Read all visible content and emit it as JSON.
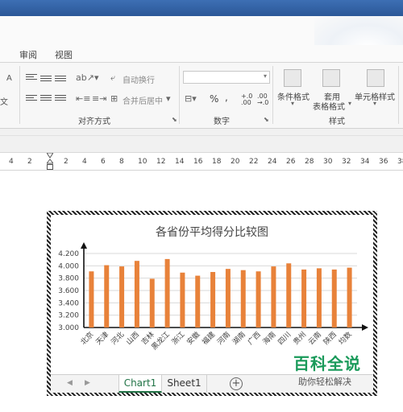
{
  "ribbon": {
    "tabs": [
      "审阅",
      "视图"
    ],
    "wrap_text": "自动换行",
    "merge_center": "合并后居中",
    "alignment_group": "对齐方式",
    "number_group": "数字",
    "percent": "%",
    "comma": ",",
    "inc_decimal": "+.0 .00",
    "dec_decimal": ".00 →.0",
    "cond_format": "条件格式",
    "table_format_1": "套用",
    "table_format_2": "表格格式",
    "cell_style": "单元格样式",
    "styles_group": "样式",
    "left_partial_1": "A",
    "left_partial_2": "文"
  },
  "ruler": {
    "labels": [
      "4",
      "2",
      "2",
      "4",
      "6",
      "8",
      "10",
      "12",
      "14",
      "16",
      "18",
      "20",
      "22",
      "24",
      "26",
      "28",
      "30",
      "32",
      "34",
      "36",
      "38"
    ]
  },
  "chart_data": {
    "type": "bar",
    "title": "各省份平均得分比较图",
    "categories": [
      "北京",
      "天津",
      "河北",
      "山西",
      "吉林",
      "黑龙江",
      "浙江",
      "安徽",
      "福建",
      "河南",
      "湖南",
      "广西",
      "海南",
      "四川",
      "贵州",
      "云南",
      "陕西",
      "均数"
    ],
    "values": [
      3.91,
      4.01,
      3.99,
      4.08,
      3.79,
      4.11,
      3.89,
      3.84,
      3.9,
      3.95,
      3.93,
      3.91,
      3.99,
      4.04,
      3.94,
      3.96,
      3.94,
      3.97
    ],
    "ylim": [
      3.0,
      4.2
    ],
    "yticks": [
      "4.200",
      "4.000",
      "3.800",
      "3.600",
      "3.400",
      "3.200",
      "3.000"
    ],
    "bar_color": "#e8823a",
    "grid": true
  },
  "sheets": {
    "tabs": [
      "Chart1",
      "Sheet1"
    ],
    "add": "+"
  },
  "watermark": {
    "title": "百科全说",
    "subtitle": "助你轻松解决"
  }
}
